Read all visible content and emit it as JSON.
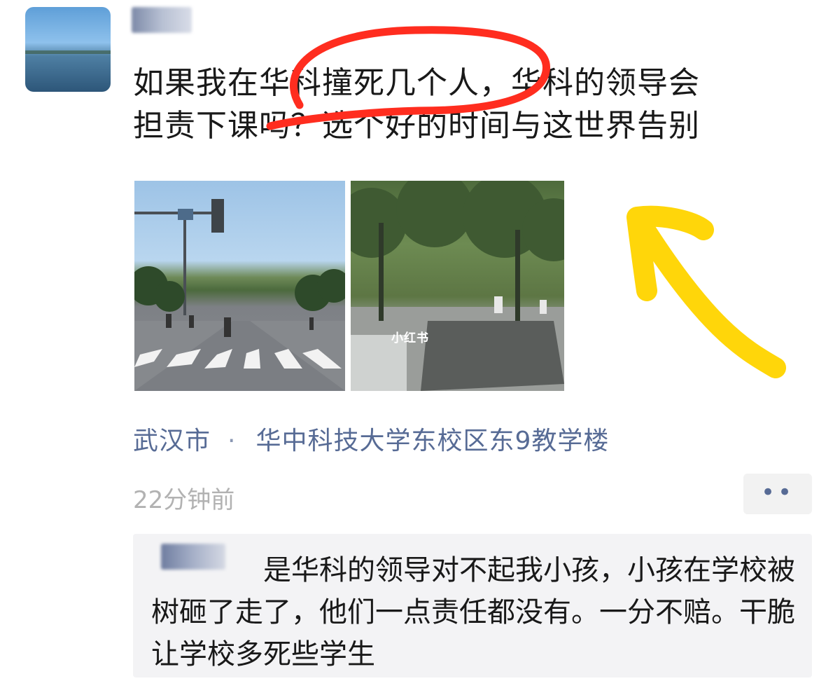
{
  "post": {
    "text": "如果我在华科撞死几个人，华科的领导会\n担责下课吗？选个好的时间与这世界告别",
    "photo_watermark": "小红书",
    "location_city": "武汉市",
    "location_separator": "·",
    "location_place": "华中科技大学东校区东9教学楼",
    "time": "22分钟前",
    "more_label": "••"
  },
  "comment": {
    "text": "是华科的领导对不起我小孩，小孩在学校被树砸了走了，他们一点责任都没有。一分不赔。干脆让学校多死些学生"
  },
  "annotations": {
    "circle_color": "#ff2d1f",
    "arrow_color": "#ffd60a"
  },
  "icons": [
    "avatar",
    "more-icon"
  ],
  "colors": {
    "link": "#576b95",
    "text": "#191919",
    "muted": "#b2b2b2",
    "comment_bg": "#f3f3f5"
  }
}
